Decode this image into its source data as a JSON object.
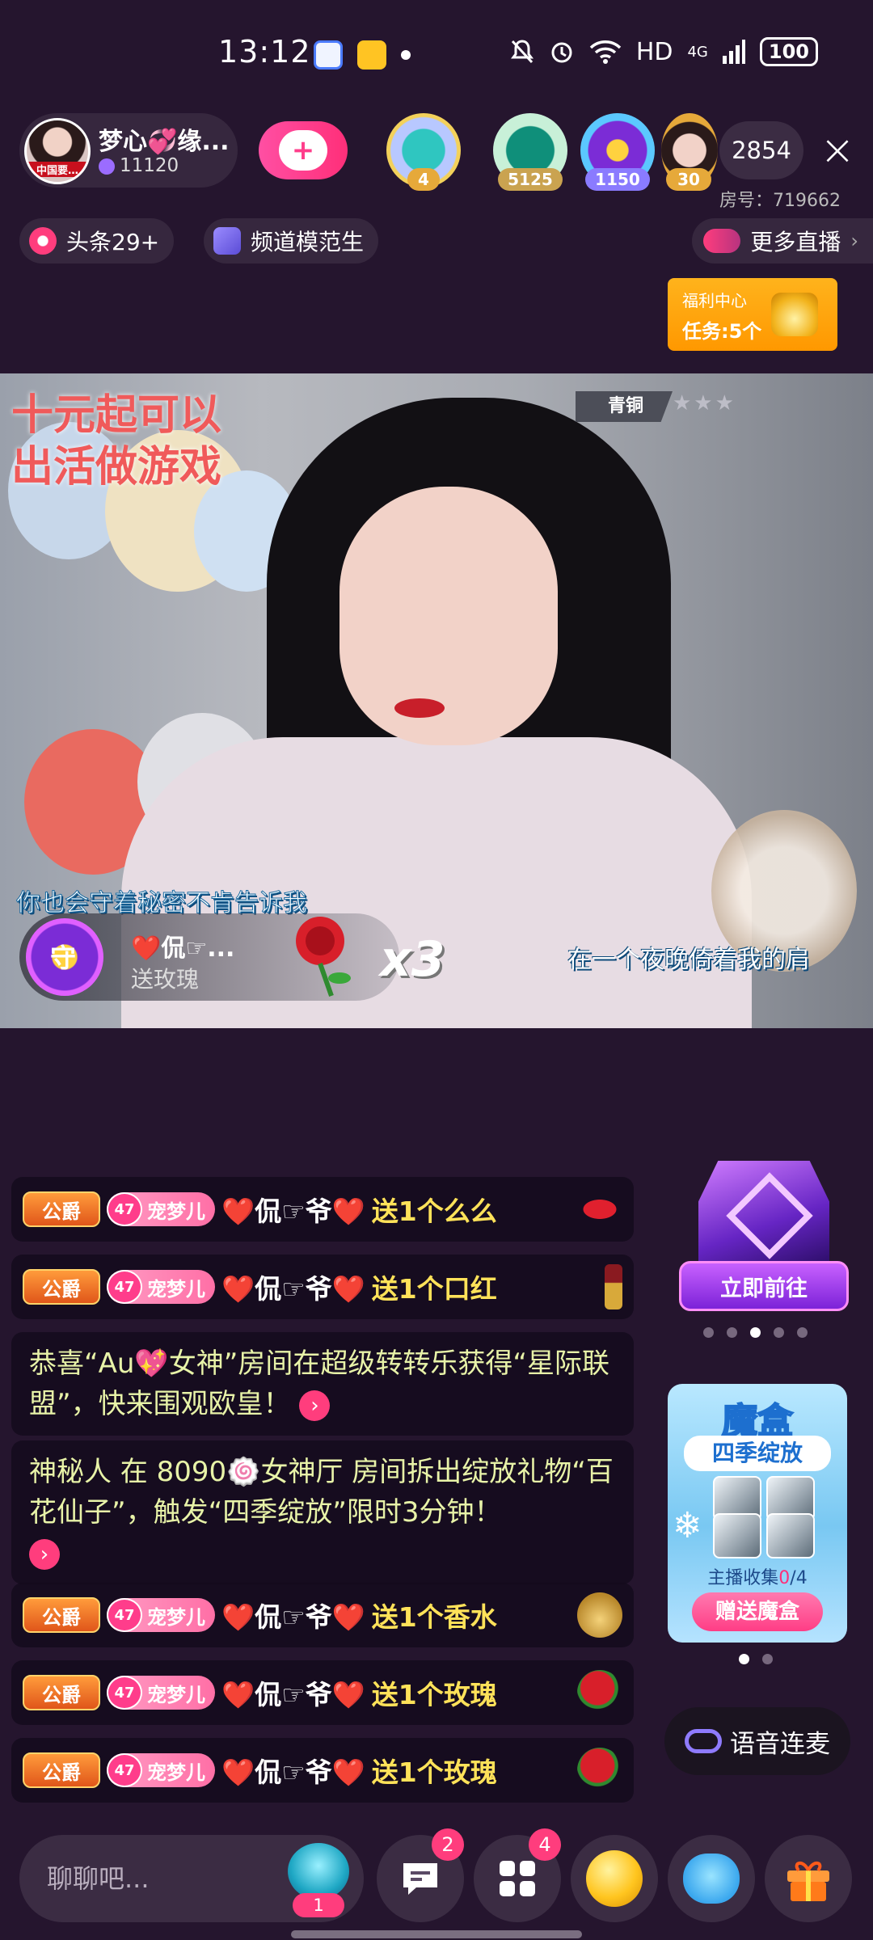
{
  "status_bar": {
    "time": "13:12",
    "network": "HD",
    "signal": "4G",
    "battery": "100"
  },
  "host": {
    "name": "梦心💞缘...",
    "avatar_tag": "中国要…",
    "fans": "11120",
    "follow_icon": "+"
  },
  "viewers": {
    "avatar_badges": [
      "4",
      "5125",
      "1150",
      "30"
    ],
    "count": "2854",
    "room_number": "房号：719662"
  },
  "channel": {
    "headline": "头条29+",
    "model": "频道模范生",
    "more_live": "更多直播"
  },
  "welfare": {
    "title": "福利中心",
    "tasks": "任务:5个"
  },
  "video": {
    "overlay_text_1": "十元起可以",
    "overlay_text_2": "出活做游戏",
    "rank_badge": "青铜",
    "rank_stars": "★★★",
    "lyric_left": "你也会守着秘密不肯告诉我",
    "lyric_right": "在一个夜晚倚着我的肩",
    "gift_popup": {
      "avatar_glyph": "守",
      "name": "❤️侃☞...",
      "action": "送玫瑰",
      "combo": "x3"
    }
  },
  "chat": [
    {
      "badge": "公爵",
      "fan_level": "47",
      "fan_club": "宠梦儿",
      "user": "❤️侃☞爷❤️",
      "message": "送1个么么",
      "gift_icon": "kiss-icon",
      "gift_color": "#d81f2a"
    },
    {
      "badge": "公爵",
      "fan_level": "47",
      "fan_club": "宠梦儿",
      "user": "❤️侃☞爷❤️",
      "message": "送1个口红",
      "gift_icon": "lipstick-icon",
      "gift_color": "#8a1a20"
    },
    {
      "system": "恭喜“Au💖女神”房间在超级转转乐获得“星际联盟”，快来围观欧皇！"
    },
    {
      "system": "神秘人 在 8090🍥女神厅 房间拆出绽放礼物“百花仙子”，触发“四季绽放”限时3分钟！"
    },
    {
      "badge": "公爵",
      "fan_level": "47",
      "fan_club": "宠梦儿",
      "user": "❤️侃☞爷❤️",
      "message": "送1个香水",
      "gift_icon": "perfume-icon",
      "gift_color": "#d8a93a"
    },
    {
      "badge": "公爵",
      "fan_level": "47",
      "fan_club": "宠梦儿",
      "user": "❤️侃☞爷❤️",
      "message": "送1个玫瑰",
      "gift_icon": "rose-icon",
      "gift_color": "#d81f2a"
    },
    {
      "badge": "公爵",
      "fan_level": "47",
      "fan_club": "宠梦儿",
      "user": "❤️侃☞爷❤️",
      "message": "送1个玫瑰",
      "gift_icon": "rose-icon",
      "gift_color": "#d81f2a"
    }
  ],
  "promo": {
    "button": "立即前往",
    "carousel_dots": 5,
    "active_dot": 3
  },
  "mohe": {
    "title": "魔盒",
    "subtitle": "四季绽放",
    "collect_label": "主播收集",
    "collect_count": "0",
    "collect_total": "/4",
    "send_button": "赠送魔盒",
    "carousel_dots": 2,
    "active_dot": 1
  },
  "voice_link": "语音连麦",
  "bottom_bar": {
    "chat_placeholder": "聊聊吧...",
    "fan_emoji_count": "1",
    "message_badge": "2",
    "apps_badge": "4"
  },
  "colors": {
    "background": "#25152e",
    "accent_pink": "#ff3d7d",
    "gift_text": "#ffe259",
    "system_text": "#e8f3a8"
  }
}
